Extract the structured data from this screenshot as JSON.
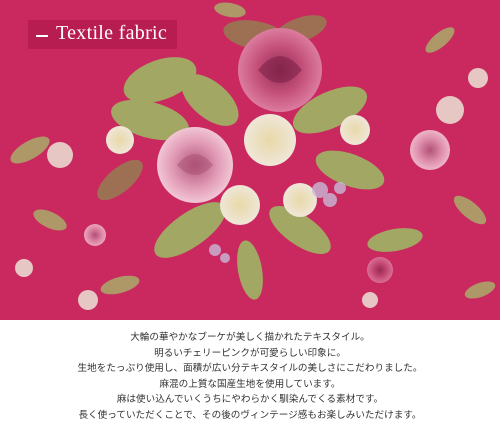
{
  "header": {
    "title": "Textile fabric"
  },
  "photo": {
    "subject": "fabric-swatch-rose-bouquet",
    "colors": {
      "fabric": "#cf2c63",
      "rose": "#e39ab4",
      "leaf": "#a9ad6b",
      "blossom": "#ece3d5"
    }
  },
  "description": {
    "lines": [
      "大輪の華やかなブーケが美しく描かれたテキスタイル。",
      "明るいチェリーピンクが可愛らしい印象に。",
      "生地をたっぷり使用し、面積が広い分テキスタイルの美しさにこだわりました。",
      "麻混の上質な国産生地を使用しています。",
      "麻は使い込んでいくうちにやわらかく馴染んでくる素材です。",
      "長く使っていただくことで、その後のヴィンテージ感もお楽しみいただけます。"
    ]
  }
}
